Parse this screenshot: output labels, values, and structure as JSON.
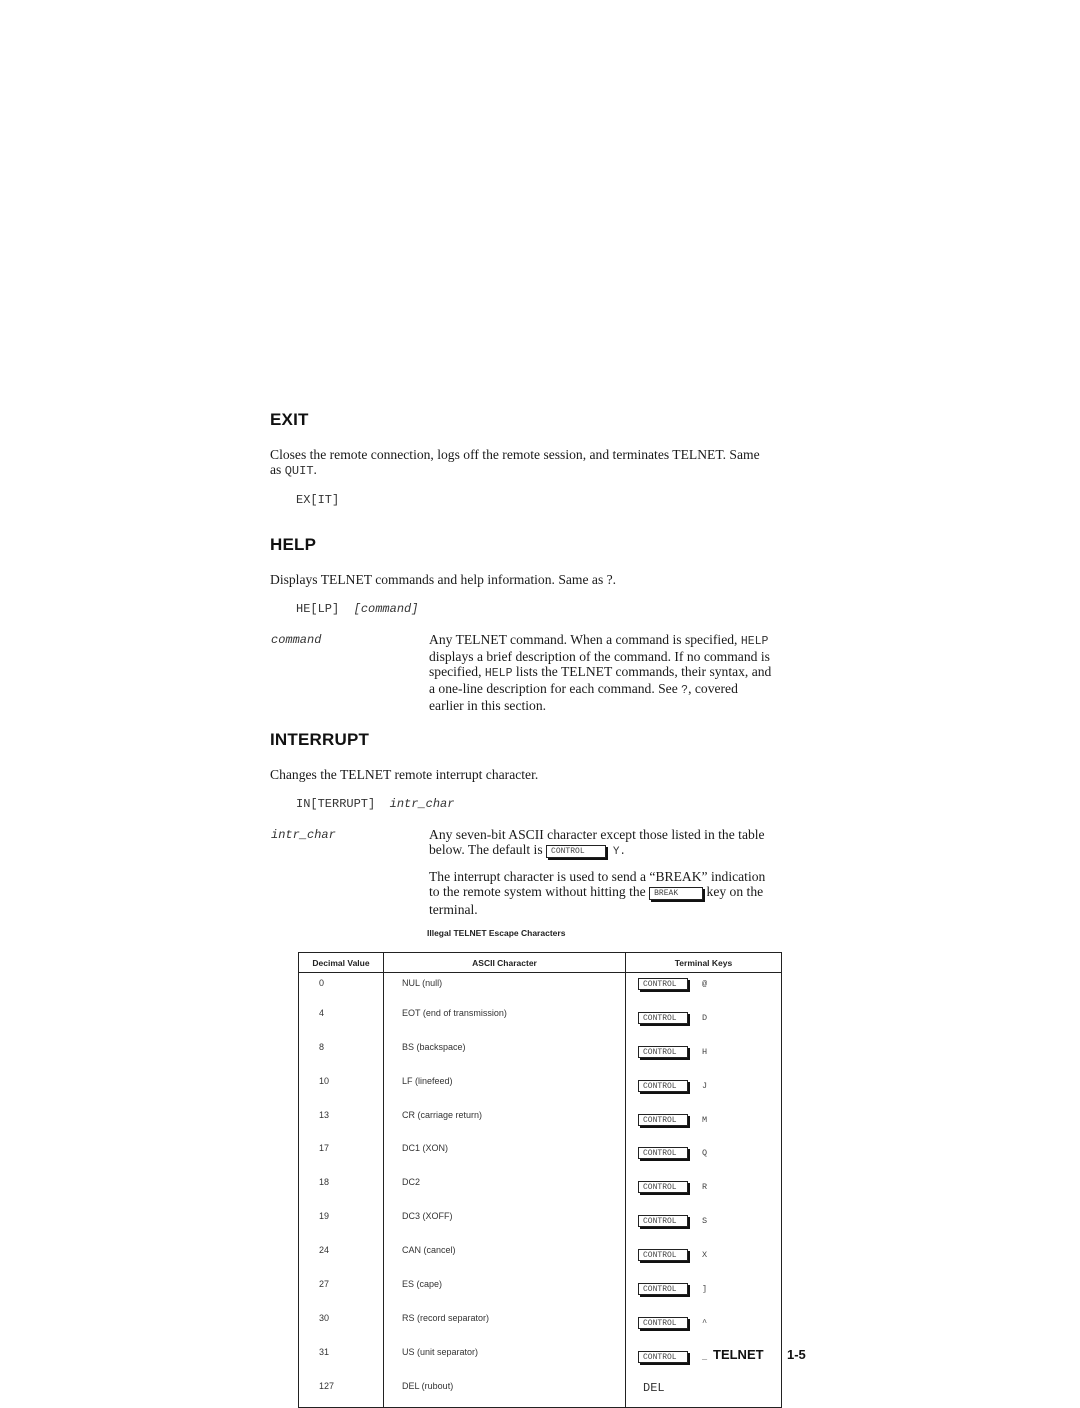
{
  "sections": {
    "exit": {
      "heading": "EXIT",
      "desc_part1": "Closes the remote connection, logs off the remote session, and terminates TELNET.  Same",
      "desc_part2_prefix": "as ",
      "desc_part2_code": "QUIT",
      "desc_part2_suffix": ".",
      "syntax": "EX[IT]"
    },
    "help": {
      "heading": "HELP",
      "desc": "Displays TELNET commands and help information.  Same as ?.",
      "syntax_cmd": "HE[LP]",
      "syntax_param": "[command]",
      "param_name": "command",
      "param_lines": [
        {
          "t1": "Any TELNET command.  When a command is specified, ",
          "code": "HELP",
          "t2": ""
        },
        {
          "t1": "displays a brief description of the command.  If no command is",
          "code": "",
          "t2": ""
        },
        {
          "t1": "specified, ",
          "code": "HELP",
          "t2": " lists the TELNET commands, their syntax, and"
        },
        {
          "t1": "a one-line description for each command.  See ",
          "code": "?",
          "t2": ", covered"
        },
        {
          "t1": "earlier in this section.",
          "code": "",
          "t2": ""
        }
      ]
    },
    "interrupt": {
      "heading": "INTERRUPT",
      "desc": "Changes the TELNET remote interrupt character.",
      "syntax_cmd": "IN[TERRUPT]",
      "syntax_param": "intr_char",
      "param_name": "intr_char",
      "param_line1": "Any seven-bit ASCII character except those listed in the table",
      "param_line2_prefix": "below.  The default is ",
      "param_line2_key": "CONTROL",
      "param_line2_suffix": "Y.",
      "note_line1": "The interrupt character is used to send a “BREAK” indication",
      "note_line2_prefix": "to the remote system without hitting the ",
      "note_line2_key": "BREAK",
      "note_line2_suffix": " key on the",
      "note_line3": "terminal."
    }
  },
  "table": {
    "caption": "Illegal TELNET Escape Characters",
    "headers": [
      "Decimal Value",
      "ASCII Character",
      "Terminal Keys"
    ],
    "rows": [
      {
        "dec": "0",
        "ascii": "NUL (null)",
        "key": "CONTROL",
        "char": "@"
      },
      {
        "dec": "4",
        "ascii": "EOT (end of transmission)",
        "key": "CONTROL",
        "char": "D"
      },
      {
        "dec": "8",
        "ascii": "BS (backspace)",
        "key": "CONTROL",
        "char": "H"
      },
      {
        "dec": "10",
        "ascii": "LF (linefeed)",
        "key": "CONTROL",
        "char": "J"
      },
      {
        "dec": "13",
        "ascii": "CR (carriage return)",
        "key": "CONTROL",
        "char": "M"
      },
      {
        "dec": "17",
        "ascii": "DC1 (XON)",
        "key": "CONTROL",
        "char": "Q"
      },
      {
        "dec": "18",
        "ascii": "DC2",
        "key": "CONTROL",
        "char": "R"
      },
      {
        "dec": "19",
        "ascii": "DC3 (XOFF)",
        "key": "CONTROL",
        "char": "S"
      },
      {
        "dec": "24",
        "ascii": "CAN (cancel)",
        "key": "CONTROL",
        "char": "X"
      },
      {
        "dec": "27",
        "ascii": "ES (cape)",
        "key": "CONTROL",
        "char": "]"
      },
      {
        "dec": "30",
        "ascii": "RS (record separator)",
        "key": "CONTROL",
        "char": "^"
      },
      {
        "dec": "31",
        "ascii": "US (unit separator)",
        "key": "CONTROL",
        "char": "_"
      },
      {
        "dec": "127",
        "ascii": "DEL (rubout)",
        "key": "",
        "char": "",
        "plain": "DEL"
      }
    ]
  },
  "footer": {
    "section": "TELNET",
    "page": "1-5"
  }
}
